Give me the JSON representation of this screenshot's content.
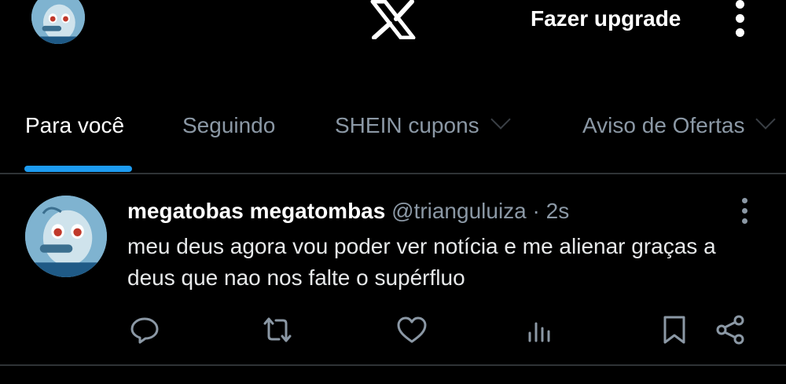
{
  "header": {
    "upgrade_label": "Fazer upgrade",
    "logo_icon": "x-logo-icon",
    "more_icon": "more-vertical-icon"
  },
  "tabs": [
    {
      "label": "Para você",
      "active": true
    },
    {
      "label": "Seguindo",
      "active": false
    },
    {
      "label": "SHEIN cupons",
      "active": false,
      "has_chevron": true
    },
    {
      "label": "Aviso de Ofertas",
      "active": false,
      "has_chevron": true
    }
  ],
  "tweet": {
    "display_name": "megatobas megatombas",
    "handle": "@trianguluiza",
    "separator": "·",
    "time": "2s",
    "text": "meu deus agora vou poder ver notícia e me alienar graças a deus que nao nos falte o supérfluo",
    "actions": [
      "reply-icon",
      "retweet-icon",
      "like-icon",
      "views-icon",
      "bookmark-icon",
      "share-icon"
    ]
  },
  "colors": {
    "background": "#000000",
    "accent": "#1d9bf0",
    "secondary_text": "#8b98a5",
    "divider": "#2f3336"
  }
}
